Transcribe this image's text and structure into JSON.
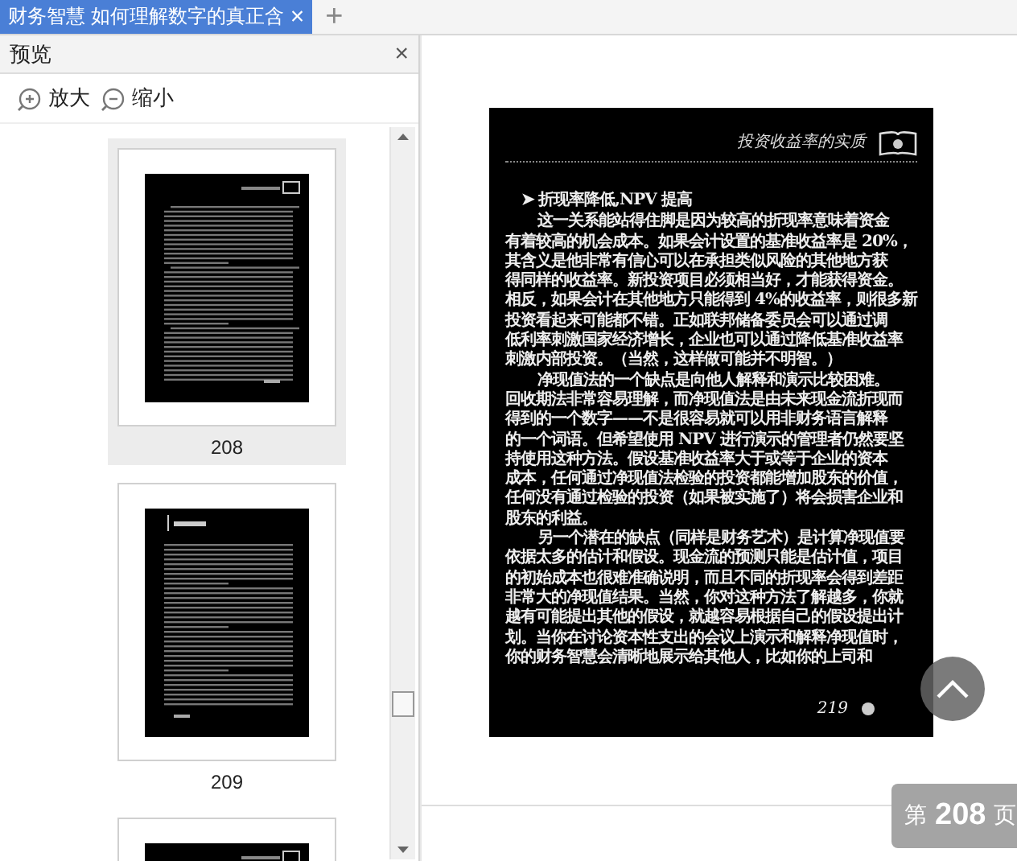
{
  "tabs": [
    {
      "label": "财务智慧 如何理解数字的真正含",
      "close": "×",
      "selected": true
    }
  ],
  "new_tab": "+",
  "sidebar": {
    "title": "预览",
    "close": "×",
    "toolbar": [
      {
        "kind": "zoom-in",
        "label": "放大"
      },
      {
        "kind": "zoom-out",
        "label": "缩小"
      }
    ],
    "thumbnails": [
      {
        "label": "208",
        "selected": true,
        "kind": "header-right"
      },
      {
        "label": "209",
        "selected": false,
        "kind": "header-left"
      },
      {
        "selected": false,
        "kind": "header-right"
      }
    ]
  },
  "page": {
    "running_head": "投资收益率的实质",
    "lines": [
      {
        "kind": "heading",
        "text": "➤ 折现率降低,NPV 提高"
      },
      {
        "kind": "indent",
        "text": "这一关系能站得住脚是因为较高的折现率意味着资金"
      },
      {
        "kind": "line",
        "text": "有着较高的机会成本。如果会计设置的基准收益率是 20%，"
      },
      {
        "kind": "line",
        "text": "其含义是他非常有信心可以在承担类似风险的其他地方获"
      },
      {
        "kind": "line",
        "text": "得同样的收益率。新投资项目必须相当好，才能获得资金。"
      },
      {
        "kind": "line",
        "text": "相反，如果会计在其他地方只能得到 4%的收益率，则很多新"
      },
      {
        "kind": "line",
        "text": "投资看起来可能都不错。正如联邦储备委员会可以通过调"
      },
      {
        "kind": "line",
        "text": "低利率刺激国家经济增长，企业也可以通过降低基准收益率"
      },
      {
        "kind": "line",
        "text": "刺激内部投资。（当然，这样做可能并不明智。）"
      },
      {
        "kind": "indent",
        "text": "净现值法的一个缺点是向他人解释和演示比较困难。"
      },
      {
        "kind": "line",
        "text": "回收期法非常容易理解，而净现值法是由未来现金流折现而"
      },
      {
        "kind": "line",
        "text": "得到的一个数字——不是很容易就可以用非财务语言解释"
      },
      {
        "kind": "line",
        "text": "的一个词语。但希望使用 NPV 进行演示的管理者仍然要坚"
      },
      {
        "kind": "line",
        "text": "持使用这种方法。假设基准收益率大于或等于企业的资本"
      },
      {
        "kind": "line",
        "text": "成本，任何通过净现值法检验的投资都能增加股东的价值，"
      },
      {
        "kind": "line",
        "text": "任何没有通过检验的投资（如果被实施了）将会损害企业和"
      },
      {
        "kind": "line",
        "text": "股东的利益。"
      },
      {
        "kind": "indent",
        "text": "另一个潜在的缺点（同样是财务艺术）是计算净现值要"
      },
      {
        "kind": "line",
        "text": "依据太多的估计和假设。现金流的预测只能是估计值，项目"
      },
      {
        "kind": "line",
        "text": "的初始成本也很难准确说明，而且不同的折现率会得到差距"
      },
      {
        "kind": "line",
        "text": "非常大的净现值结果。当然，你对这种方法了解越多，你就"
      },
      {
        "kind": "line",
        "text": "越有可能提出其他的假设，就越容易根据自己的假设提出计"
      },
      {
        "kind": "line",
        "text": "划。当你在讨论资本性支出的会议上演示和解释净现值时，"
      },
      {
        "kind": "line",
        "text": "你的财务智慧会清晰地展示给其他人，比如你的上司和"
      }
    ],
    "folio": "219"
  },
  "page_indicator": {
    "prefix": "第",
    "number": "208",
    "suffix": "页"
  }
}
